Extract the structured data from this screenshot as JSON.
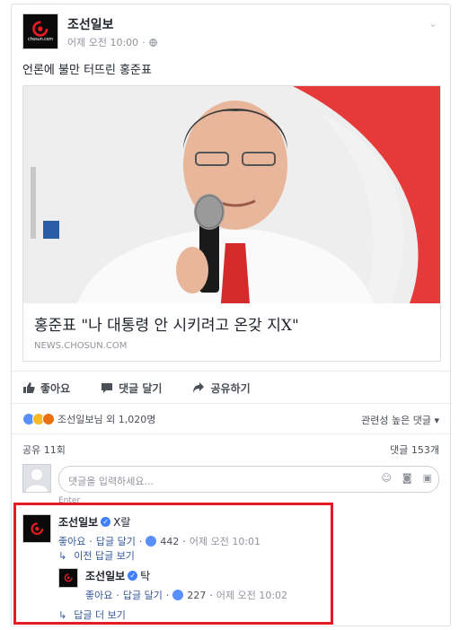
{
  "post": {
    "page_name": "조선일보",
    "time": "어제 오전 10:00",
    "text": "언론에 불만 터뜨린 홍준표",
    "logo_text": "chosun.com"
  },
  "link": {
    "headline": "홍준표 \"나 대통령 안 시키려고 온갖 지X\"",
    "domain": "NEWS.CHOSUN.COM"
  },
  "actions": {
    "like": "좋아요",
    "comment": "댓글 달기",
    "share": "공유하기"
  },
  "stats": {
    "reactions_text": "조선일보님 외 1,020명",
    "sort_label": "관련성 높은 댓글",
    "shares": "공유 11회",
    "comments": "댓글 153개"
  },
  "comment_box": {
    "placeholder": "댓글을 입력하세요...",
    "hint": "Enter"
  },
  "comments": [
    {
      "author": "조선일보",
      "text": "X랄",
      "like": "좋아요",
      "reply": "답글 달기",
      "likes": "442",
      "time": "어제 오전 10:01"
    },
    {
      "author": "조선일보",
      "text": "탁",
      "like": "좋아요",
      "reply": "답글 달기",
      "likes": "227",
      "time": "어제 오전 10:02"
    }
  ],
  "more": {
    "prev_replies": "이전 답글 보기",
    "more_replies": "답글 더 보기"
  },
  "colors": {
    "link": "#365899",
    "highlight": "#e51b24",
    "like_blue": "#5890ff"
  }
}
